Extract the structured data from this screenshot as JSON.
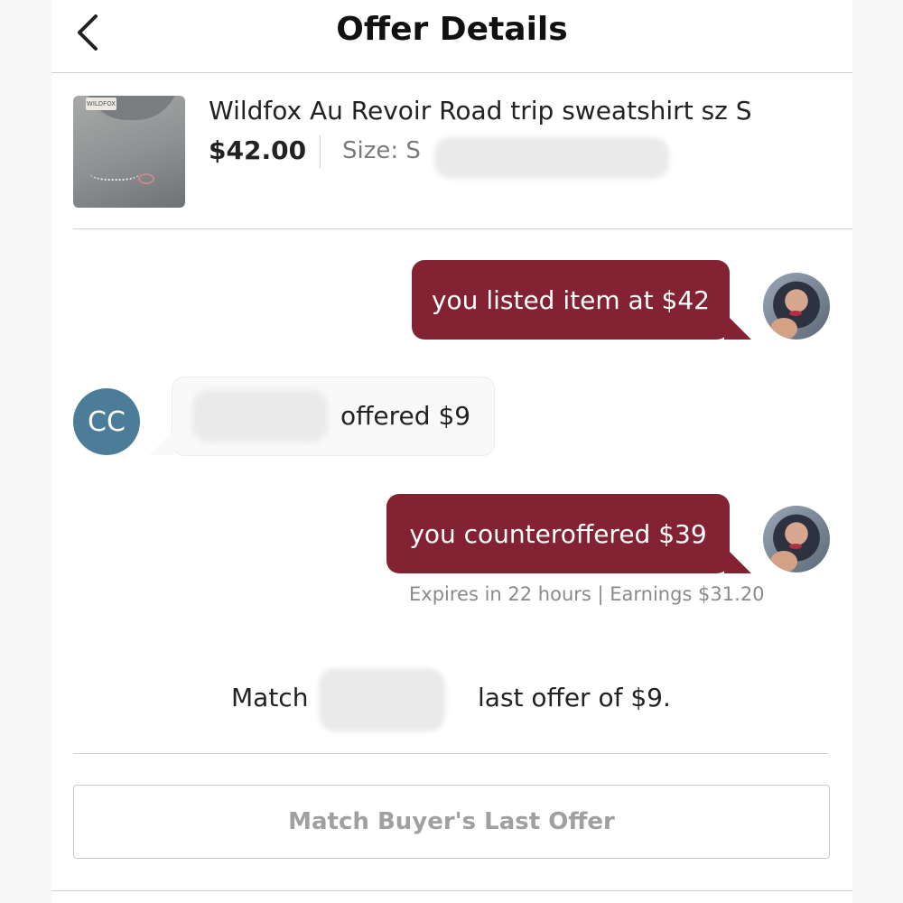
{
  "header": {
    "title": "Offer Details",
    "back_icon": "chevron-left-icon"
  },
  "listing": {
    "title": "Wildfox Au Revoir Road trip sweatshirt sz S",
    "price": "$42.00",
    "size": "Size: S",
    "thumbnail_tag": "WILDFOX"
  },
  "chat": {
    "messages": [
      {
        "from": "seller",
        "text": "you listed item at $42"
      },
      {
        "from": "buyer",
        "text": "offered $9",
        "avatar_initials": "CC"
      },
      {
        "from": "seller",
        "text": "you counteroffered $39"
      }
    ],
    "meta": "Expires in 22 hours | Earnings $31.20"
  },
  "match": {
    "prefix": "Match",
    "suffix": "last offer of $9.",
    "button_label": "Match Buyer's Last Offer"
  },
  "colors": {
    "seller_bubble": "#822233",
    "buyer_avatar": "#4b7d98",
    "button_text": "#a0a0a0"
  }
}
